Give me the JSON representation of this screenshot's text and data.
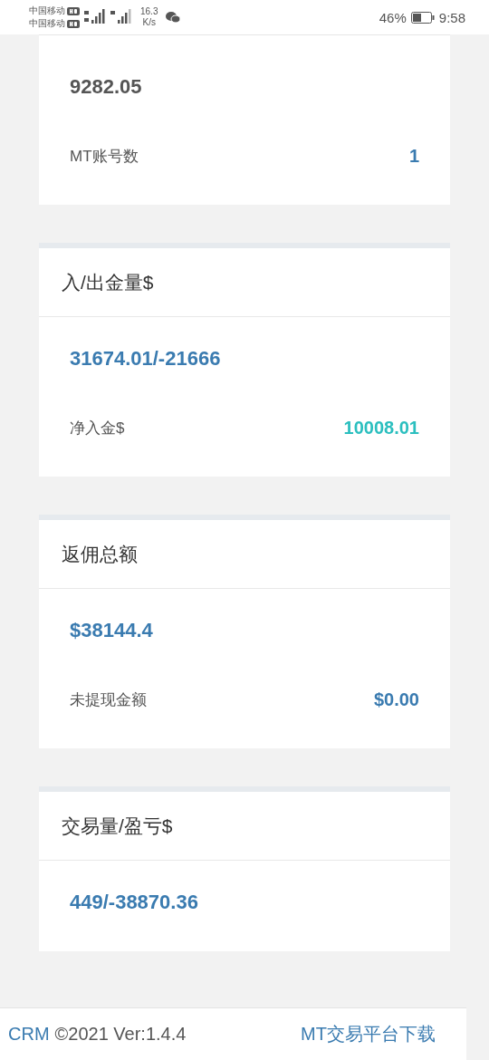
{
  "status_bar": {
    "carriers": [
      "中国移动",
      "中国移动"
    ],
    "net_speed": [
      "16.3",
      "K/s"
    ],
    "battery_percent": "46%",
    "time": "9:58"
  },
  "cards": [
    {
      "value": "9282.05",
      "color": "#555555",
      "row": {
        "label": "MT账号数",
        "value": "1",
        "color": "#3a7bb0"
      }
    },
    {
      "title": "入/出金量$",
      "value": "31674.01/-21666",
      "color": "#3a7bb0",
      "row": {
        "label": "净入金$",
        "value": "10008.01",
        "color": "#2bbfbf"
      }
    },
    {
      "title": "返佣总额",
      "value": "$38144.4",
      "color": "#3a7bb0",
      "row": {
        "label": "未提现金额",
        "value": "$0.00",
        "color": "#3a7bb0"
      }
    },
    {
      "title": "交易量/盈亏$",
      "value": "449/-38870.36",
      "color": "#3a7bb0"
    }
  ],
  "footer": {
    "brand": "CRM",
    "version": "©2021 Ver:1.4.4",
    "link": "MT交易平台下载"
  }
}
